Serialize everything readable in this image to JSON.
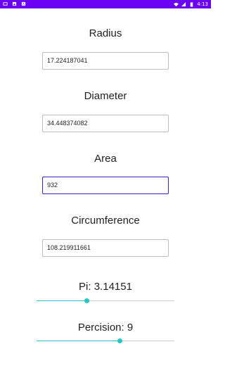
{
  "status_bar": {
    "time": "4:13",
    "icons_left": [
      "notification-icon",
      "photo-icon",
      "android-icon"
    ],
    "icons_right": [
      "wifi-icon",
      "signal-icon",
      "battery-icon"
    ],
    "background_color": "#6a00f4"
  },
  "radius": {
    "label": "Radius",
    "value": "17.224187041"
  },
  "diameter": {
    "label": "Diameter",
    "value": "34.448374082"
  },
  "area": {
    "label": "Area",
    "value": "932"
  },
  "circumference": {
    "label": "Circumference",
    "value": "108.219911661"
  },
  "pi": {
    "label": "Pi: 3.14151",
    "slider_fraction": 0.36
  },
  "precision": {
    "label": "Percision: 9",
    "slider_fraction": 0.6
  },
  "accent_color": "#26c6c6"
}
